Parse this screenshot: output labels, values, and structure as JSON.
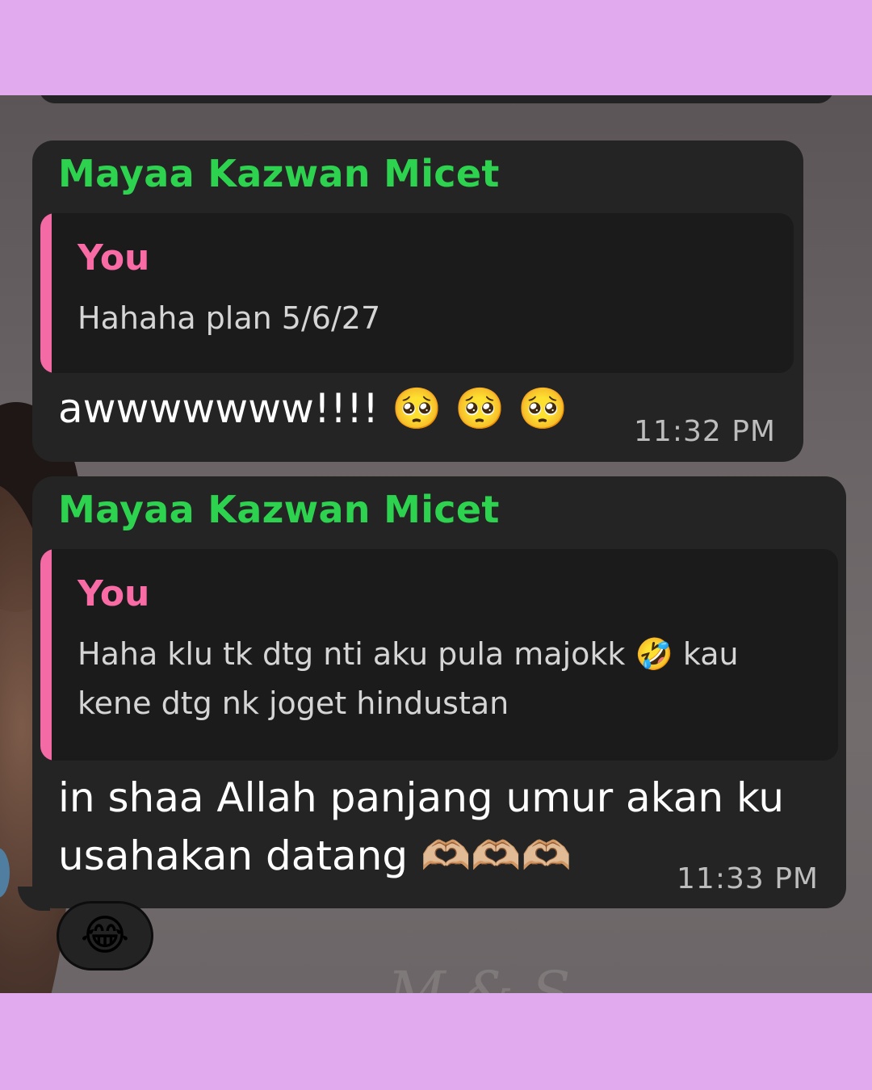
{
  "colors": {
    "frame": "#e1a9ee",
    "bubble": "#242424",
    "sender_name": "#2dd24f",
    "quote_author": "#f86ba5",
    "quote_bar": "#f36aa4"
  },
  "messages": [
    {
      "sender": "Mayaa Kazwan Micet",
      "quote_author": "You",
      "quote_text": "Hahaha plan 5/6/27",
      "text": "awwwwwww!!!! 🥺 🥺 🥺",
      "time": "11:32 PM"
    },
    {
      "sender": "Mayaa Kazwan Micet",
      "quote_author": "You",
      "quote_text": "Haha klu tk dtg nti aku pula majokk 🤣 kau kene dtg nk joget hindustan",
      "text": "in shaa Allah panjang umur akan ku usahakan datang 🫶🏼🫶🏼🫶🏼",
      "time": "11:33 PM"
    }
  ],
  "reaction": {
    "emoji": "😂",
    "icon": "tears-of-joy-icon"
  },
  "watermark": "M & S"
}
